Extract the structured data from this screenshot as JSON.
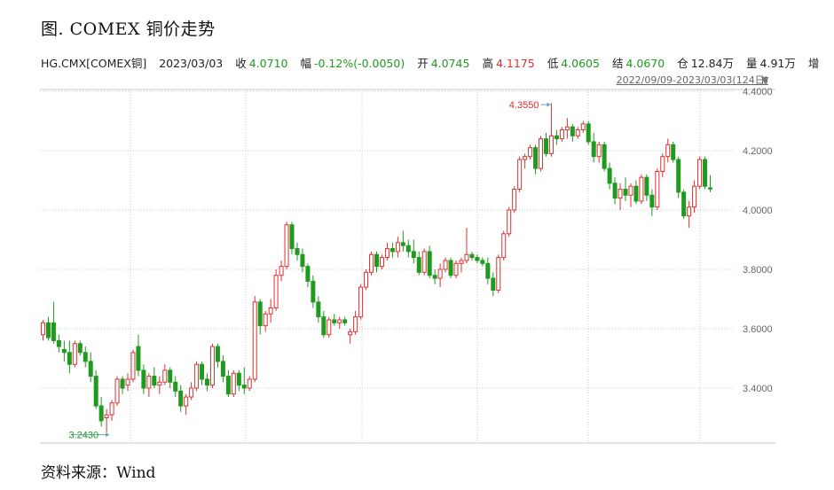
{
  "title": "图. COMEX 铜价走势",
  "quote": {
    "symbol": "HG.CMX[COMEX铜]",
    "date": "2023/03/03",
    "close_label": "收",
    "close_value": "4.0710",
    "change_label": "幅",
    "change_value": "-0.12%(-0.0050)",
    "open_label": "开",
    "open_value": "4.0745",
    "high_label": "高",
    "high_value": "4.1175",
    "low_label": "低",
    "low_value": "4.0605",
    "settle_label": "结",
    "settle_value": "4.0670",
    "oi_label": "仓",
    "oi_value": "12.84万",
    "volume_label": "量",
    "volume_value": "4.91万",
    "more_label": "增"
  },
  "range_label": "2022/09/09-2023/03/03(124日)",
  "source": "资料来源：Wind",
  "colors": {
    "up": "#e03030",
    "down": "#1f9a1f",
    "grid": "#c8c8c8",
    "axis_text": "#666666",
    "high_marker": "#e03030",
    "low_marker": "#1f9a1f"
  },
  "chart_data": {
    "type": "candlestick",
    "title": "",
    "xlabel": "",
    "ylabel": "",
    "ylim": [
      3.2,
      4.4
    ],
    "yticks": [
      "4.4000",
      "4.2000",
      "4.0000",
      "3.8000",
      "3.6000",
      "3.4000"
    ],
    "grid": true,
    "high_marker": {
      "label": "4.3550",
      "value": 4.355
    },
    "low_marker": {
      "label": "3.2430",
      "value": 3.243
    },
    "series": [
      {
        "ohlc": [
          [
            3.58,
            3.63,
            3.56,
            3.62
          ],
          [
            3.62,
            3.64,
            3.56,
            3.57
          ],
          [
            3.62,
            3.69,
            3.55,
            3.56
          ],
          [
            3.56,
            3.58,
            3.52,
            3.54
          ],
          [
            3.53,
            3.56,
            3.49,
            3.52
          ],
          [
            3.52,
            3.56,
            3.45,
            3.48
          ],
          [
            3.48,
            3.56,
            3.47,
            3.55
          ],
          [
            3.55,
            3.56,
            3.51,
            3.52
          ],
          [
            3.52,
            3.54,
            3.47,
            3.49
          ],
          [
            3.49,
            3.52,
            3.42,
            3.44
          ],
          [
            3.44,
            3.46,
            3.33,
            3.34
          ],
          [
            3.34,
            3.37,
            3.27,
            3.29
          ],
          [
            3.3,
            3.33,
            3.25,
            3.31
          ],
          [
            3.31,
            3.36,
            3.29,
            3.35
          ],
          [
            3.35,
            3.44,
            3.34,
            3.43
          ],
          [
            3.43,
            3.44,
            3.38,
            3.4
          ],
          [
            3.41,
            3.45,
            3.39,
            3.43
          ],
          [
            3.43,
            3.53,
            3.42,
            3.52
          ],
          [
            3.54,
            3.58,
            3.44,
            3.46
          ],
          [
            3.46,
            3.48,
            3.38,
            3.4
          ],
          [
            3.4,
            3.45,
            3.37,
            3.44
          ],
          [
            3.44,
            3.47,
            3.4,
            3.41
          ],
          [
            3.41,
            3.44,
            3.38,
            3.42
          ],
          [
            3.42,
            3.48,
            3.41,
            3.46
          ],
          [
            3.46,
            3.47,
            3.4,
            3.42
          ],
          [
            3.42,
            3.44,
            3.37,
            3.39
          ],
          [
            3.39,
            3.41,
            3.32,
            3.34
          ],
          [
            3.34,
            3.38,
            3.31,
            3.37
          ],
          [
            3.37,
            3.42,
            3.36,
            3.4
          ],
          [
            3.4,
            3.49,
            3.39,
            3.48
          ],
          [
            3.48,
            3.49,
            3.41,
            3.43
          ],
          [
            3.43,
            3.45,
            3.39,
            3.41
          ],
          [
            3.41,
            3.55,
            3.4,
            3.54
          ],
          [
            3.54,
            3.55,
            3.47,
            3.49
          ],
          [
            3.49,
            3.51,
            3.42,
            3.44
          ],
          [
            3.44,
            3.46,
            3.37,
            3.38
          ],
          [
            3.38,
            3.46,
            3.37,
            3.45
          ],
          [
            3.45,
            3.46,
            3.39,
            3.41
          ],
          [
            3.41,
            3.47,
            3.38,
            3.4
          ],
          [
            3.4,
            3.44,
            3.39,
            3.43
          ],
          [
            3.43,
            3.71,
            3.42,
            3.69
          ],
          [
            3.69,
            3.7,
            3.58,
            3.61
          ],
          [
            3.61,
            3.66,
            3.59,
            3.65
          ],
          [
            3.65,
            3.7,
            3.62,
            3.67
          ],
          [
            3.67,
            3.8,
            3.66,
            3.78
          ],
          [
            3.78,
            3.83,
            3.76,
            3.81
          ],
          [
            3.81,
            3.96,
            3.8,
            3.95
          ],
          [
            3.95,
            3.96,
            3.85,
            3.87
          ],
          [
            3.87,
            3.89,
            3.83,
            3.85
          ],
          [
            3.85,
            3.87,
            3.79,
            3.81
          ],
          [
            3.81,
            3.82,
            3.74,
            3.76
          ],
          [
            3.76,
            3.78,
            3.67,
            3.69
          ],
          [
            3.69,
            3.71,
            3.62,
            3.64
          ],
          [
            3.64,
            3.66,
            3.57,
            3.58
          ],
          [
            3.58,
            3.64,
            3.57,
            3.63
          ],
          [
            3.63,
            3.65,
            3.61,
            3.62
          ],
          [
            3.62,
            3.64,
            3.6,
            3.63
          ],
          [
            3.63,
            3.64,
            3.61,
            3.62
          ],
          [
            3.58,
            3.6,
            3.55,
            3.59
          ],
          [
            3.59,
            3.66,
            3.58,
            3.64
          ],
          [
            3.64,
            3.75,
            3.63,
            3.74
          ],
          [
            3.74,
            3.8,
            3.73,
            3.79
          ],
          [
            3.79,
            3.86,
            3.78,
            3.85
          ],
          [
            3.85,
            3.86,
            3.79,
            3.81
          ],
          [
            3.81,
            3.85,
            3.8,
            3.84
          ],
          [
            3.84,
            3.89,
            3.83,
            3.87
          ],
          [
            3.87,
            3.89,
            3.84,
            3.86
          ],
          [
            3.86,
            3.91,
            3.84,
            3.89
          ],
          [
            3.89,
            3.93,
            3.86,
            3.88
          ],
          [
            3.88,
            3.9,
            3.84,
            3.86
          ],
          [
            3.86,
            3.9,
            3.82,
            3.84
          ],
          [
            3.84,
            3.86,
            3.78,
            3.79
          ],
          [
            3.79,
            3.87,
            3.78,
            3.86
          ],
          [
            3.86,
            3.88,
            3.77,
            3.78
          ],
          [
            3.78,
            3.8,
            3.75,
            3.77
          ],
          [
            3.77,
            3.82,
            3.74,
            3.8
          ],
          [
            3.8,
            3.84,
            3.79,
            3.83
          ],
          [
            3.83,
            3.84,
            3.77,
            3.78
          ],
          [
            3.78,
            3.83,
            3.77,
            3.82
          ],
          [
            3.82,
            3.84,
            3.79,
            3.83
          ],
          [
            3.83,
            3.94,
            3.82,
            3.85
          ],
          [
            3.85,
            3.86,
            3.83,
            3.84
          ],
          [
            3.84,
            3.85,
            3.82,
            3.83
          ],
          [
            3.83,
            3.84,
            3.81,
            3.82
          ],
          [
            3.82,
            3.84,
            3.75,
            3.77
          ],
          [
            3.77,
            3.79,
            3.71,
            3.73
          ],
          [
            3.73,
            3.85,
            3.72,
            3.84
          ],
          [
            3.84,
            3.93,
            3.83,
            3.92
          ],
          [
            3.92,
            4.01,
            3.91,
            4.0
          ],
          [
            4.0,
            4.08,
            3.99,
            4.07
          ],
          [
            4.07,
            4.18,
            4.06,
            4.17
          ],
          [
            4.17,
            4.19,
            4.14,
            4.18
          ],
          [
            4.18,
            4.22,
            4.17,
            4.21
          ],
          [
            4.21,
            4.22,
            4.12,
            4.14
          ],
          [
            4.14,
            4.25,
            4.13,
            4.24
          ],
          [
            4.24,
            4.26,
            4.18,
            4.19
          ],
          [
            4.19,
            4.36,
            4.18,
            4.25
          ],
          [
            4.25,
            4.27,
            4.22,
            4.24
          ],
          [
            4.24,
            4.28,
            4.23,
            4.27
          ],
          [
            4.27,
            4.31,
            4.24,
            4.28
          ],
          [
            4.28,
            4.29,
            4.23,
            4.25
          ],
          [
            4.25,
            4.28,
            4.24,
            4.27
          ],
          [
            4.27,
            4.3,
            4.26,
            4.29
          ],
          [
            4.29,
            4.3,
            4.22,
            4.23
          ],
          [
            4.23,
            4.26,
            4.16,
            4.18
          ],
          [
            4.18,
            4.23,
            4.16,
            4.22
          ],
          [
            4.22,
            4.23,
            4.13,
            4.14
          ],
          [
            4.14,
            4.16,
            4.07,
            4.09
          ],
          [
            4.09,
            4.11,
            4.02,
            4.04
          ],
          [
            4.04,
            4.09,
            4.0,
            4.07
          ],
          [
            4.07,
            4.11,
            4.03,
            4.05
          ],
          [
            4.05,
            4.09,
            4.01,
            4.08
          ],
          [
            4.08,
            4.1,
            4.02,
            4.03
          ],
          [
            4.03,
            4.12,
            4.02,
            4.11
          ],
          [
            4.11,
            4.12,
            4.03,
            4.05
          ],
          [
            4.05,
            4.07,
            3.98,
            4.01
          ],
          [
            4.01,
            4.14,
            4.0,
            4.13
          ],
          [
            4.13,
            4.19,
            4.11,
            4.18
          ],
          [
            4.18,
            4.24,
            4.16,
            4.22
          ],
          [
            4.22,
            4.23,
            4.16,
            4.17
          ],
          [
            4.17,
            4.18,
            4.04,
            4.06
          ],
          [
            4.06,
            4.07,
            3.97,
            3.98
          ],
          [
            3.98,
            4.03,
            3.94,
            4.01
          ],
          [
            4.01,
            4.1,
            3.99,
            4.08
          ],
          [
            4.08,
            4.18,
            4.07,
            4.17
          ],
          [
            4.17,
            4.18,
            4.07,
            4.08
          ],
          [
            4.0745,
            4.1175,
            4.0605,
            4.071
          ]
        ]
      }
    ]
  }
}
